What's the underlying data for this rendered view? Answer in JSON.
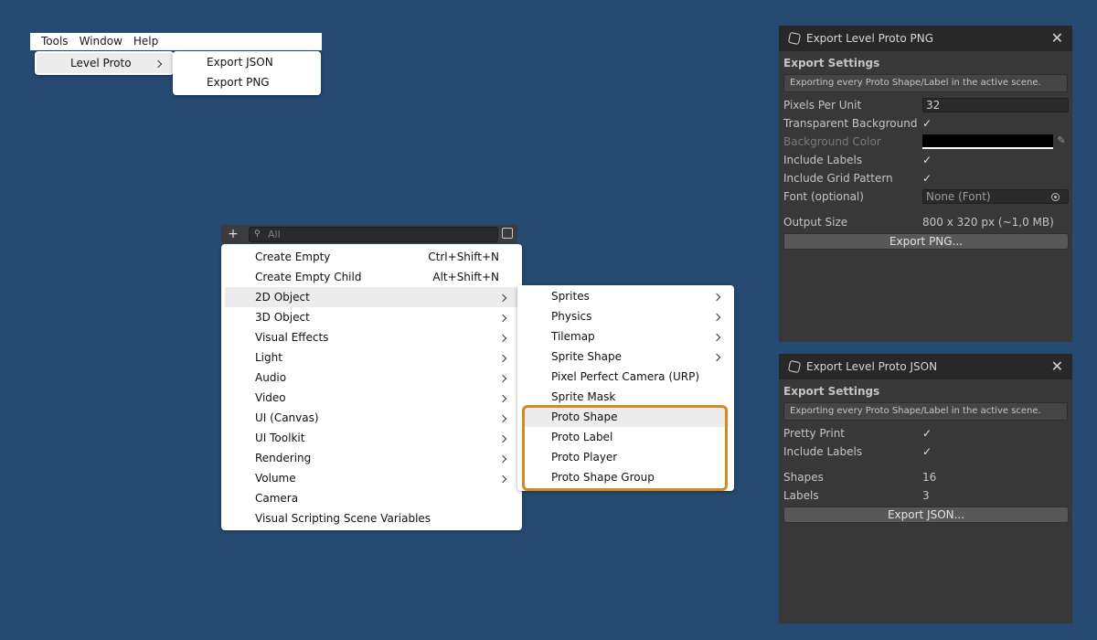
{
  "menubar": {
    "items": [
      "Tools",
      "Window",
      "Help"
    ]
  },
  "tools_menu": {
    "items": [
      "Level Proto"
    ]
  },
  "level_proto_submenu": {
    "items": [
      "Export JSON",
      "Export PNG"
    ]
  },
  "hierarchy_toolbar": {
    "add_label": "+",
    "search_placeholder": "All"
  },
  "context_menu": {
    "items": [
      {
        "label": "Create Empty",
        "shortcut": "Ctrl+Shift+N"
      },
      {
        "label": "Create Empty Child",
        "shortcut": "Alt+Shift+N"
      },
      {
        "label": "2D Object",
        "shortcut": ""
      },
      {
        "label": "3D Object",
        "shortcut": ""
      },
      {
        "label": "Visual Effects",
        "shortcut": ""
      },
      {
        "label": "Light",
        "shortcut": ""
      },
      {
        "label": "Audio",
        "shortcut": ""
      },
      {
        "label": "Video",
        "shortcut": ""
      },
      {
        "label": "UI (Canvas)",
        "shortcut": ""
      },
      {
        "label": "UI Toolkit",
        "shortcut": ""
      },
      {
        "label": "Rendering",
        "shortcut": ""
      },
      {
        "label": "Volume",
        "shortcut": ""
      },
      {
        "label": "Camera",
        "shortcut": ""
      },
      {
        "label": "Visual Scripting Scene Variables",
        "shortcut": ""
      }
    ]
  },
  "object2d_submenu": {
    "items": [
      "Sprites",
      "Physics",
      "Tilemap",
      "Sprite Shape",
      "Pixel Perfect Camera (URP)",
      "Sprite Mask",
      "Proto Shape",
      "Proto Label",
      "Proto Player",
      "Proto Shape Group"
    ]
  },
  "png_window": {
    "title": "Export Level Proto PNG",
    "section": "Export Settings",
    "help": "Exporting every Proto Shape/Label in the active scene.",
    "pixels_per_unit_label": "Pixels Per Unit",
    "pixels_per_unit_value": "32",
    "transparent_bg_label": "Transparent Background",
    "transparent_bg_checked": "✓",
    "bg_color_label": "Background Color",
    "bg_color": "#000000",
    "include_labels_label": "Include Labels",
    "include_labels_checked": "✓",
    "include_grid_label": "Include Grid Pattern",
    "include_grid_checked": "✓",
    "font_label": "Font (optional)",
    "font_value": "None (Font)",
    "output_size_label": "Output Size",
    "output_size_value": "800 x 320 px (~1,0 MB)",
    "export_button": "Export PNG..."
  },
  "json_window": {
    "title": "Export Level Proto JSON",
    "section": "Export Settings",
    "help": "Exporting every Proto Shape/Label in the active scene.",
    "pretty_print_label": "Pretty Print",
    "pretty_print_checked": "✓",
    "include_labels_label": "Include Labels",
    "include_labels_checked": "✓",
    "shapes_label": "Shapes",
    "shapes_value": "16",
    "labels_label": "Labels",
    "labels_value": "3",
    "export_button": "Export JSON..."
  },
  "colors": {
    "desktop": "#264a72",
    "highlight": "#d88724",
    "unity_panel": "#383838"
  }
}
